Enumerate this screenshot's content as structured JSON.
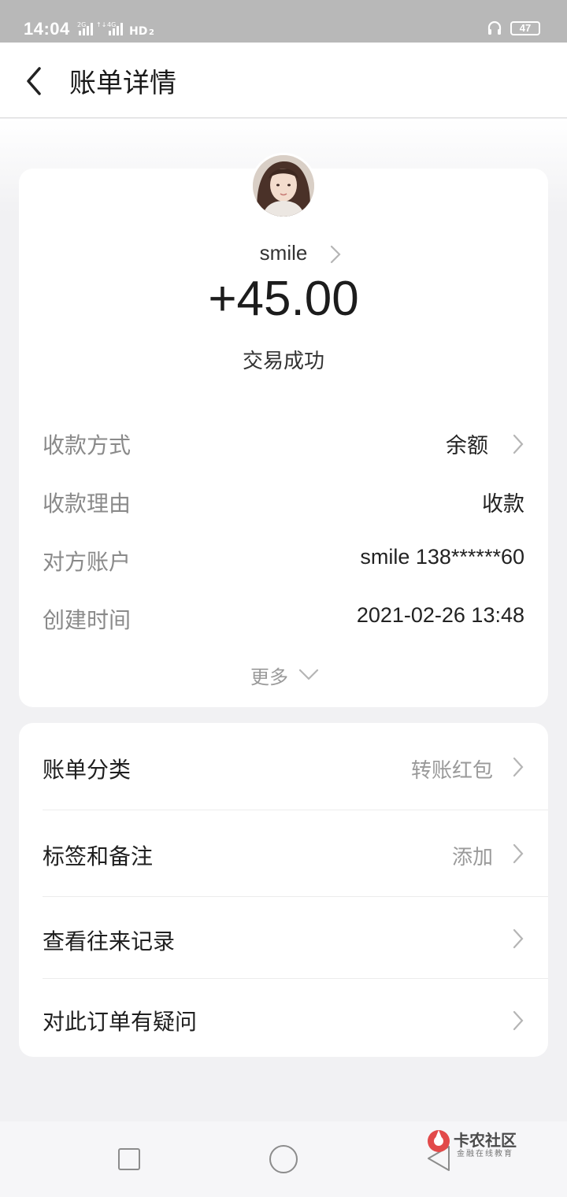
{
  "status_bar": {
    "time": "14:04",
    "battery": "47"
  },
  "header": {
    "title": "账单详情"
  },
  "transaction": {
    "counterparty": "smile",
    "amount": "+45.00",
    "status": "交易成功"
  },
  "details": [
    {
      "label": "收款方式",
      "value": "余额"
    },
    {
      "label": "收款理由",
      "value": "收款"
    },
    {
      "label": "对方账户",
      "value": "smile 138******60"
    },
    {
      "label": "创建时间",
      "value": "2021-02-26 13:48"
    }
  ],
  "more_label": "更多",
  "menu": [
    {
      "label": "账单分类",
      "value": "转账红包"
    },
    {
      "label": "标签和备注",
      "value": "添加"
    },
    {
      "label": "查看往来记录",
      "value": ""
    },
    {
      "label": "对此订单有疑问",
      "value": ""
    }
  ],
  "watermark": {
    "title": "卡农社区",
    "subtitle": "金融在线教育"
  },
  "colors": {
    "background": "#f1f1f3",
    "card": "#ffffff",
    "status_bar": "#b8b8b8"
  }
}
